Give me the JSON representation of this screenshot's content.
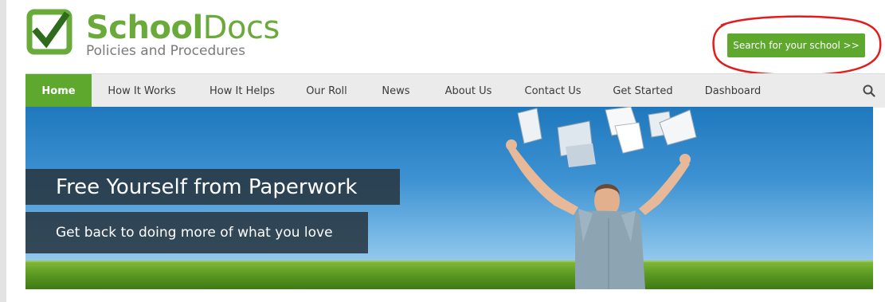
{
  "logo": {
    "title_bold": "School",
    "title_light": "Docs",
    "subtitle": "Policies and Procedures",
    "icon": "checkbox-check-icon",
    "brand_color": "#5fa82e"
  },
  "header": {
    "search_button": "Search for your school >>"
  },
  "nav": {
    "items": [
      {
        "label": "Home",
        "active": true
      },
      {
        "label": "How It Works"
      },
      {
        "label": "How It Helps"
      },
      {
        "label": "Our Roll"
      },
      {
        "label": "News"
      },
      {
        "label": "About Us"
      },
      {
        "label": "Contact Us"
      },
      {
        "label": "Get Started"
      },
      {
        "label": "Dashboard"
      }
    ],
    "search_icon": "search-icon",
    "bar_color": "#ebebeb"
  },
  "hero": {
    "headline": "Free Yourself from Paperwork",
    "subheadline": "Get back to doing more of what you love",
    "image": "man-throwing-papers-sky-field"
  },
  "annotation": {
    "shape": "red-circle-highlight",
    "color": "#e21b1b"
  }
}
